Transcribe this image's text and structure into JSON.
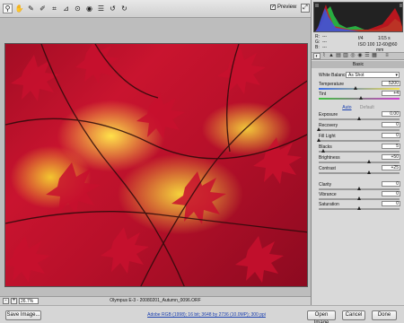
{
  "toolbar": {
    "tools": [
      {
        "icon": "zoom-icon",
        "glyph": "⚲"
      },
      {
        "icon": "hand-icon",
        "glyph": "✋"
      },
      {
        "icon": "white-balance-icon",
        "glyph": "✎"
      },
      {
        "icon": "color-sampler-icon",
        "glyph": "✐"
      },
      {
        "icon": "crop-icon",
        "glyph": "⌗"
      },
      {
        "icon": "straighten-icon",
        "glyph": "⊿"
      },
      {
        "icon": "retouch-icon",
        "glyph": "⊙"
      },
      {
        "icon": "red-eye-icon",
        "glyph": "◉"
      },
      {
        "icon": "preferences-icon",
        "glyph": "☰"
      },
      {
        "icon": "rotate-left-icon",
        "glyph": "↺"
      },
      {
        "icon": "rotate-right-icon",
        "glyph": "↻"
      }
    ],
    "preview_label": "Preview",
    "preview_checked": "✓"
  },
  "camera_info": {
    "r": "R:",
    "g": "G:",
    "b": "B:",
    "r_val": "---",
    "g_val": "---",
    "b_val": "---",
    "aperture": "f/4",
    "shutter": "1/15 s",
    "iso": "ISO 100",
    "focal": "12-60@60 mm"
  },
  "panel": {
    "title": "Basic",
    "white_balance_label": "White Balance:",
    "white_balance_value": "As Shot",
    "auto_label": "Auto",
    "default_label": "Default",
    "sliders": [
      {
        "label": "Temperature",
        "value": "5200",
        "pos": 0.45
      },
      {
        "label": "Tint",
        "value": "+4",
        "pos": 0.52
      },
      {
        "label": "Exposure",
        "value": "0.00",
        "pos": 0.5
      },
      {
        "label": "Recovery",
        "value": "0",
        "pos": 0.0
      },
      {
        "label": "Fill Light",
        "value": "0",
        "pos": 0.0
      },
      {
        "label": "Blacks",
        "value": "5",
        "pos": 0.05
      },
      {
        "label": "Brightness",
        "value": "+50",
        "pos": 0.62
      },
      {
        "label": "Contrast",
        "value": "+25",
        "pos": 0.62
      },
      {
        "label": "Clarity",
        "value": "0",
        "pos": 0.5
      },
      {
        "label": "Vibrance",
        "value": "0",
        "pos": 0.5
      },
      {
        "label": "Saturation",
        "value": "0",
        "pos": 0.5
      }
    ]
  },
  "status": {
    "zoom_out": "-",
    "zoom_in": "+",
    "zoom_value": "26.7%",
    "filename": "Olympus E-3  -  20080201_Autumn_0096.ORF"
  },
  "bottom": {
    "save_label": "Save Image...",
    "workflow_label": "Adobe RGB (1998); 16 bit; 3648 by 2736 (10.0MP); 300 ppi",
    "open_label": "Open Image",
    "cancel_label": "Cancel",
    "done_label": "Done"
  }
}
